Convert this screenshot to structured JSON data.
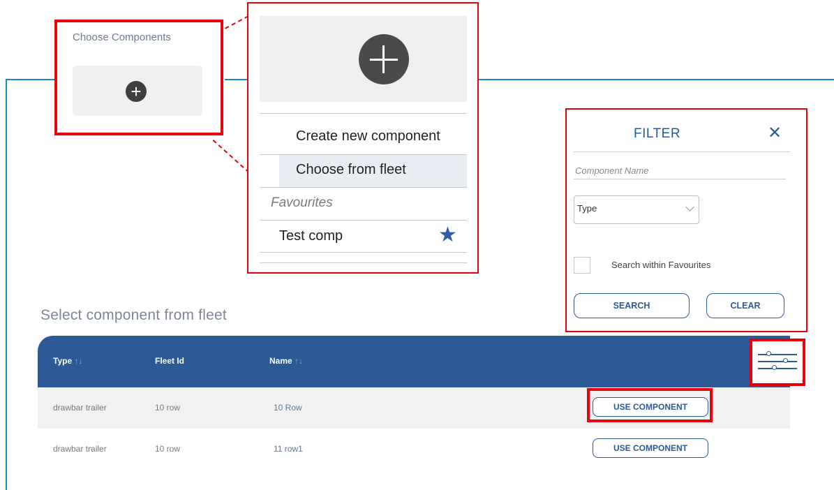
{
  "choose_components": {
    "label": "Choose Components"
  },
  "dropdown": {
    "items": [
      "Create new component",
      "Choose from fleet"
    ],
    "favourites_label": "Favourites",
    "favourite_items": [
      {
        "label": "Test comp",
        "starred": true
      }
    ]
  },
  "filter": {
    "title": "FILTER",
    "close_symbol": "✕",
    "component_name_placeholder": "Component Name",
    "type_select_value": "Type",
    "favourites_checkbox_label": "Search within Favourites",
    "favourites_checked": false,
    "search_label": "SEARCH",
    "clear_label": "CLEAR"
  },
  "table": {
    "title": "Select component from fleet",
    "headers": [
      {
        "label": "Type",
        "sort": "↑↓"
      },
      {
        "label": "Fleet Id",
        "sort": ""
      },
      {
        "label": "Name",
        "sort": "↑↓"
      }
    ],
    "rows": [
      {
        "type": "drawbar trailer",
        "fleet_id": "10 row",
        "name": "10 Row",
        "action": "USE COMPONENT"
      },
      {
        "type": "drawbar trailer",
        "fleet_id": "10 row",
        "name": "11 row1",
        "action": "USE COMPONENT"
      }
    ]
  },
  "colors": {
    "accent": "#2b5a96",
    "highlight_border": "#e8000b",
    "frame_line": "#1e88c7"
  },
  "icons": [
    "plus-circle-icon",
    "star-icon",
    "close-icon",
    "chevron-down-icon",
    "filter-sliders-icon"
  ]
}
